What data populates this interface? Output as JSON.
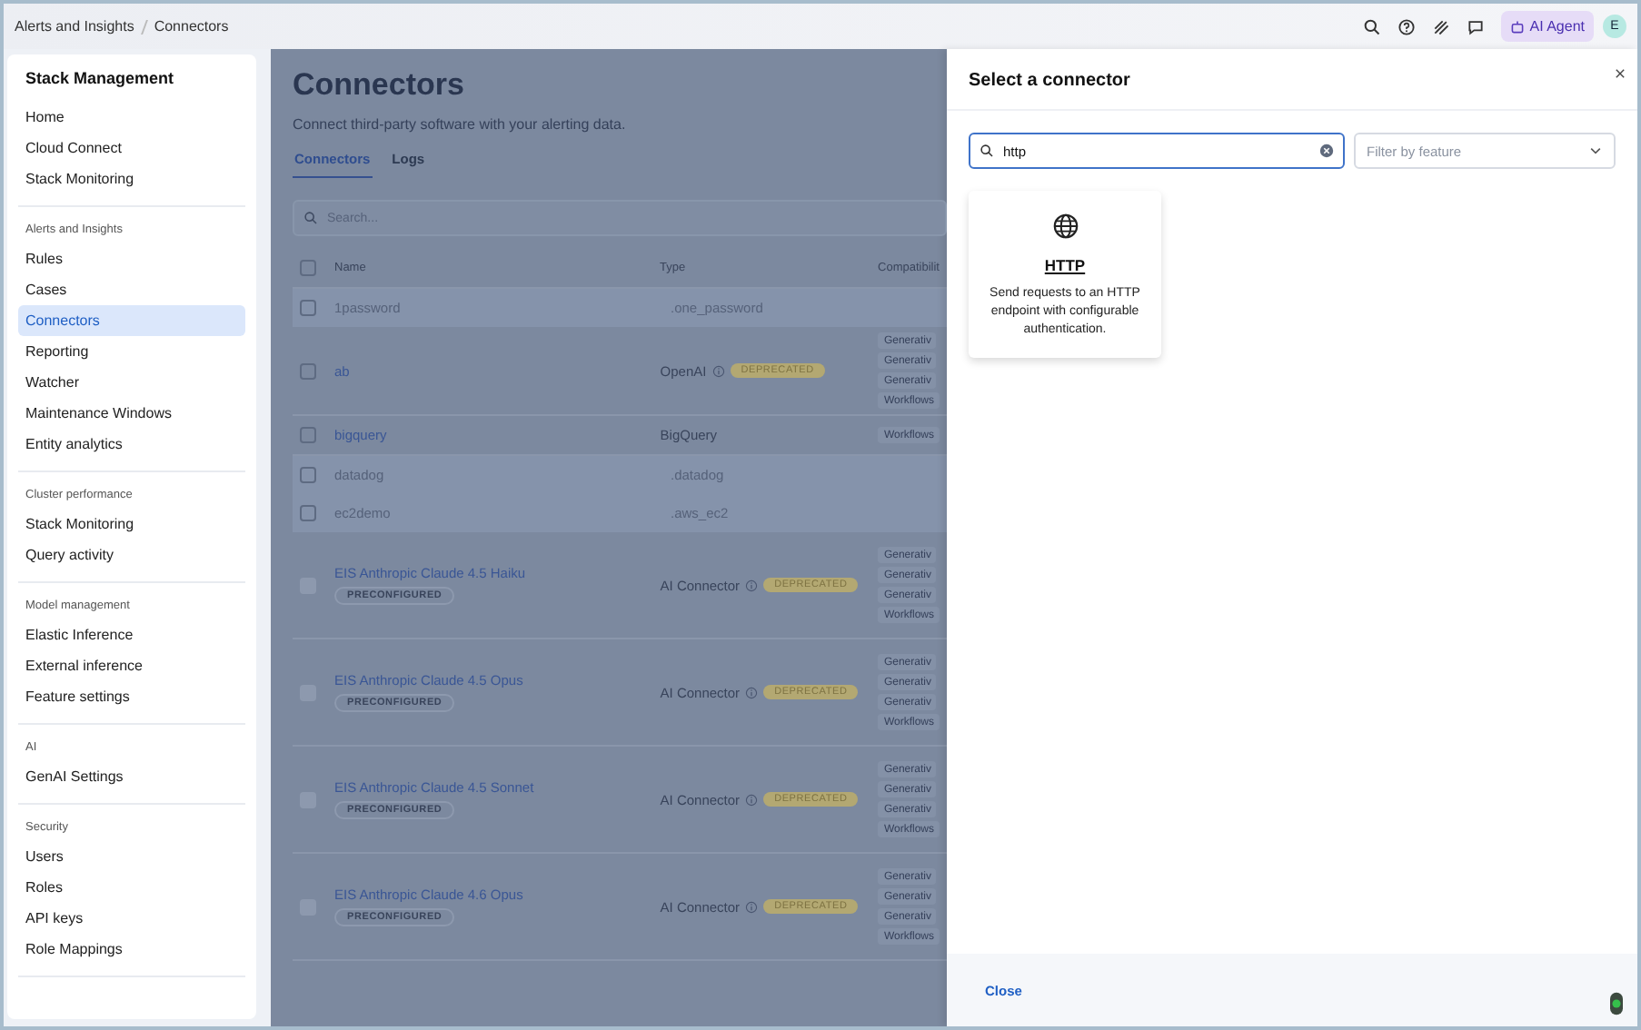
{
  "top_bar": {
    "breadcrumbs": [
      "Alerts and Insights",
      "Connectors"
    ],
    "ai_button": "AI Agent",
    "avatar": "E"
  },
  "sidebar": {
    "title": "Stack Management",
    "groups": [
      {
        "items": [
          {
            "label": "Home",
            "selected": false
          },
          {
            "label": "Cloud Connect",
            "selected": false
          },
          {
            "label": "Stack Monitoring",
            "selected": false
          }
        ]
      },
      {
        "title": "Alerts and Insights",
        "items": [
          {
            "label": "Rules",
            "selected": false
          },
          {
            "label": "Cases",
            "selected": false
          },
          {
            "label": "Connectors",
            "selected": true
          },
          {
            "label": "Reporting",
            "selected": false
          },
          {
            "label": "Watcher",
            "selected": false
          },
          {
            "label": "Maintenance Windows",
            "selected": false
          },
          {
            "label": "Entity analytics",
            "selected": false
          }
        ]
      },
      {
        "title": "Cluster performance",
        "items": [
          {
            "label": "Stack Monitoring",
            "selected": false
          },
          {
            "label": "Query activity",
            "selected": false
          }
        ]
      },
      {
        "title": "Model management",
        "items": [
          {
            "label": "Elastic Inference",
            "selected": false
          },
          {
            "label": "External inference",
            "selected": false
          },
          {
            "label": "Feature settings",
            "selected": false
          }
        ]
      },
      {
        "title": "AI",
        "items": [
          {
            "label": "GenAI Settings",
            "selected": false
          }
        ]
      },
      {
        "title": "Security",
        "items": [
          {
            "label": "Users",
            "selected": false
          },
          {
            "label": "Roles",
            "selected": false
          },
          {
            "label": "API keys",
            "selected": false
          },
          {
            "label": "Role Mappings",
            "selected": false
          }
        ]
      }
    ]
  },
  "page": {
    "title": "Connectors",
    "subtitle": "Connect third-party software with your alerting data.",
    "tabs": [
      {
        "label": "Connectors",
        "selected": true
      },
      {
        "label": "Logs",
        "selected": false
      }
    ],
    "search": {
      "placeholder": "Search..."
    },
    "table": {
      "select_all_checked": false,
      "columns": [
        "Name",
        "Type",
        "Compatibilit"
      ],
      "rows": [
        {
          "name": "1password",
          "type": ".one_password",
          "disabled": true,
          "deprecated": false,
          "compatibility": []
        },
        {
          "name": "ab",
          "type": "OpenAI",
          "disabled": false,
          "deprecated": true,
          "deprecated_label": "DEPRECATED",
          "compatibility": [
            "Generativ",
            "Generativ",
            "Generativ",
            "Workflows"
          ]
        },
        {
          "name": "bigquery",
          "type": "BigQuery",
          "disabled": false,
          "deprecated": false,
          "compatibility": [
            "Workflows"
          ]
        },
        {
          "name": "datadog",
          "type": ".datadog",
          "disabled": true,
          "deprecated": false,
          "compatibility": []
        },
        {
          "name": "ec2demo",
          "type": ".aws_ec2",
          "disabled": true,
          "deprecated": false,
          "compatibility": []
        },
        {
          "name": "EIS Anthropic Claude 4.5 Haiku",
          "badge": "PRECONFIGURED",
          "type": "AI Connector",
          "disabled": false,
          "deprecated": true,
          "deprecated_label": "DEPRECATED",
          "compatibility": [
            "Generativ",
            "Generativ",
            "Generativ",
            "Workflows"
          ]
        },
        {
          "name": "EIS Anthropic Claude 4.5 Opus",
          "badge": "PRECONFIGURED",
          "type": "AI Connector",
          "disabled": false,
          "deprecated": true,
          "deprecated_label": "DEPRECATED",
          "compatibility": [
            "Generativ",
            "Generativ",
            "Generativ",
            "Workflows"
          ]
        },
        {
          "name": "EIS Anthropic Claude 4.5 Sonnet",
          "badge": "PRECONFIGURED",
          "type": "AI Connector",
          "disabled": false,
          "deprecated": true,
          "deprecated_label": "DEPRECATED",
          "compatibility": [
            "Generativ",
            "Generativ",
            "Generativ",
            "Workflows"
          ]
        },
        {
          "name": "EIS Anthropic Claude 4.6 Opus",
          "badge": "PRECONFIGURED",
          "type": "AI Connector",
          "disabled": false,
          "deprecated": true,
          "deprecated_label": "DEPRECATED",
          "compatibility": [
            "Generativ",
            "Generativ",
            "Generativ",
            "Workflows"
          ]
        }
      ]
    }
  },
  "flyout": {
    "title": "Select a connector",
    "search": {
      "value": "http"
    },
    "filter": {
      "placeholder": "Filter by feature"
    },
    "cards": [
      {
        "title": "HTTP",
        "description": "Send requests to an HTTP endpoint with configurable authentication."
      }
    ],
    "footer_button": "Close"
  }
}
